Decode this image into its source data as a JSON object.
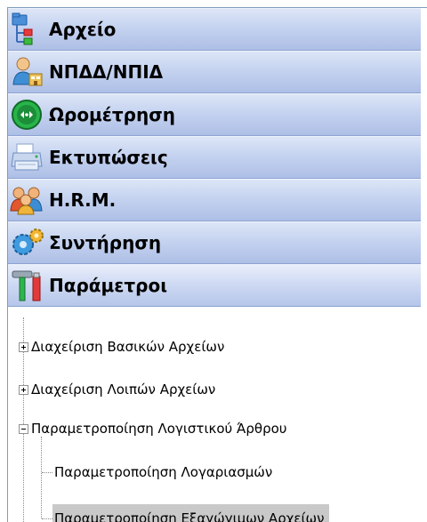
{
  "nav": {
    "groups": [
      {
        "label": "Αρχείο",
        "icon": "folder-tree-icon"
      },
      {
        "label": "ΝΠΔΔ/ΝΠΙΔ",
        "icon": "user-organization-icon"
      },
      {
        "label": "Ωρομέτρηση",
        "icon": "green-clock-arrows-icon"
      },
      {
        "label": "Εκτυπώσεις",
        "icon": "printer-icon"
      },
      {
        "label": "H.R.M.",
        "icon": "people-group-icon"
      },
      {
        "label": "Συντήρηση",
        "icon": "gears-icon"
      },
      {
        "label": "Παράμετροι",
        "icon": "hammer-tools-icon"
      }
    ]
  },
  "tree": {
    "nodes": [
      {
        "label": "Διαχείριση Βασικών Αρχείων",
        "expander": "plus"
      },
      {
        "label": "Διαχείριση Λοιπών Αρχείων",
        "expander": "plus"
      },
      {
        "label": "Παραμετροποίηση Λογιστικού Άρθρου",
        "expander": "minus"
      },
      {
        "label": "Παραμετροποίηση Λογαριασμών"
      },
      {
        "label": "Παραμετροποίηση Εξαγώγιμων Αρχείων",
        "selected": true
      }
    ]
  },
  "colors": {
    "header_gradient_top": "#dde6f7",
    "header_gradient_bottom": "#aebfe6",
    "selection": "#c9c9c9"
  }
}
